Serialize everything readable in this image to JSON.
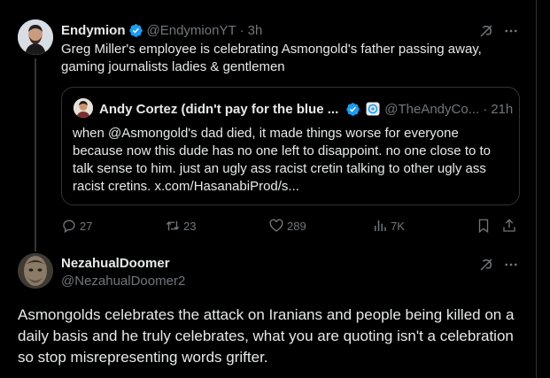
{
  "tweet": {
    "author_name": "Endymion",
    "author_handle": "@EndymionYT",
    "time": "3h",
    "text": "Greg Miller's employee is celebrating Asmongold's father passing away, gaming journalists ladies & gentlemen",
    "quote": {
      "author_name": "Andy Cortez (didn't pay for the blue ...",
      "author_handle": "@TheAndyCo...",
      "time": "21h",
      "text": "when @Asmongold's dad died, it made things worse for everyone because now this dude has no one left to disappoint. no one close to to talk sense to him. just an ugly ass racist cretin talking to other ugly ass racist cretins. x.com/HasanabiProd/s..."
    },
    "actions": {
      "replies": "27",
      "reposts": "23",
      "likes": "289",
      "views": "7K"
    }
  },
  "reply": {
    "author_name": "NezahualDoomer",
    "author_handle": "@NezahualDoomer2",
    "text": "Asmongolds celebrates the attack on Iranians and people being killed on a daily basis and he truly celebrates, what you are quoting isn't a celebration so stop misrepresenting words grifter."
  },
  "colors": {
    "background": "#000000",
    "text": "#e7e9ea",
    "muted": "#71767b",
    "verified": "#1d9bf0",
    "border": "#2f3336"
  },
  "icons": [
    "verified-badge-icon",
    "grok-icon",
    "more-icon",
    "reply-icon",
    "repost-icon",
    "like-icon",
    "views-icon",
    "bookmark-icon",
    "share-icon",
    "affiliate-badge-icon"
  ]
}
